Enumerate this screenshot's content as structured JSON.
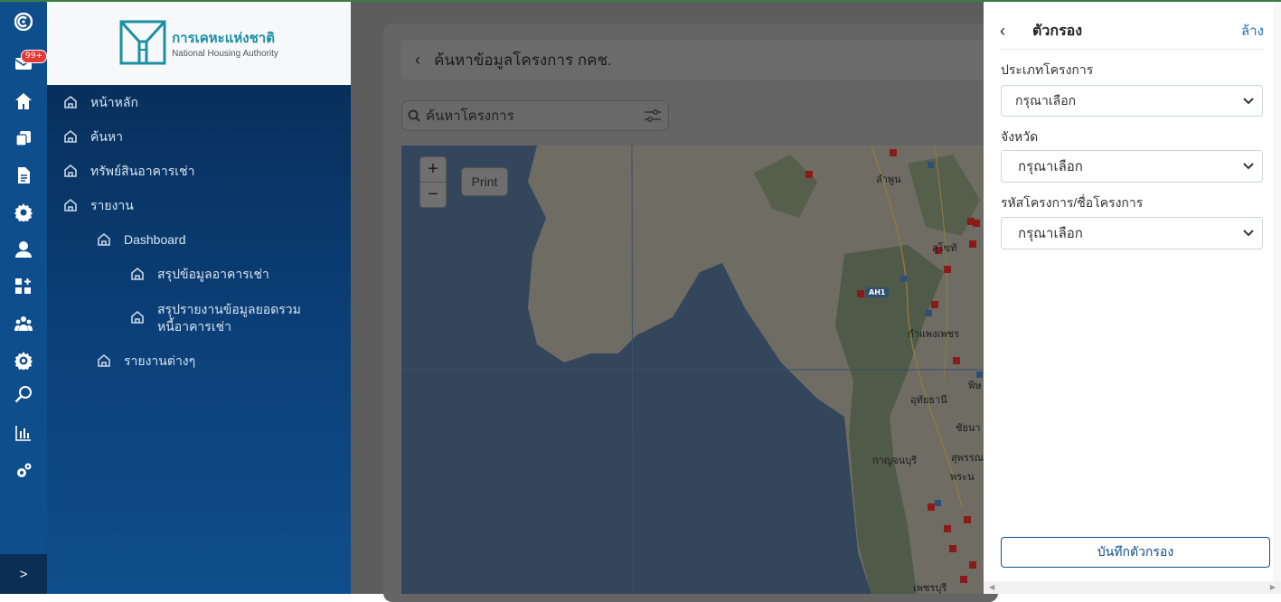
{
  "colors": {
    "rail_bg": "#0f4e8c",
    "nav_bg": "#072a52",
    "accent_link": "#1f6fc5",
    "badge": "#e53935"
  },
  "rail": {
    "badge": "99+",
    "icons": [
      "app-logo-icon",
      "mail-icon",
      "home-icon",
      "copy-icon",
      "document-icon",
      "gear-icon",
      "user-icon",
      "widgets-icon",
      "group-icon",
      "coin-settings-icon",
      "search-icon",
      "chart-icon",
      "settings-icon"
    ],
    "expand_label": ">"
  },
  "logo": {
    "thai": "การเคหะแห่งชาติ",
    "english": "National Housing Authority"
  },
  "nav": {
    "items": [
      {
        "label": "หน้าหลัก"
      },
      {
        "label": "ค้นหา"
      },
      {
        "label": "ทรัพย์สินอาคารเช่า"
      },
      {
        "label": "รายงาน"
      },
      {
        "label": "Dashboard"
      },
      {
        "label": "สรุปข้อมูลอาคารเช่า"
      },
      {
        "label": "สรุปรายงานข้อมูลยอดรวมหนี้อาคารเช่า"
      },
      {
        "label": "รายงานต่างๆ"
      }
    ]
  },
  "main": {
    "title": "ค้นหาข้อมูลโครงการ กคช.",
    "search_placeholder": "ค้นหาโครงการ"
  },
  "map": {
    "zoom_in": "+",
    "zoom_out": "−",
    "print": "Print",
    "road_badge": "AH1",
    "labels": [
      {
        "id": "lamphun",
        "text": "ลำพูน"
      },
      {
        "id": "sukhothai",
        "text": "สุโขทั"
      },
      {
        "id": "kamphaengphet",
        "text": "กำแพงเพชร"
      },
      {
        "id": "uthaithani",
        "text": "อุทัยธานี"
      },
      {
        "id": "chainat",
        "text": "ชัยนา"
      },
      {
        "id": "suphanburi",
        "text": "สุพรรณบุรี"
      },
      {
        "id": "kanchanaburi",
        "text": "กาญจนบุรี"
      },
      {
        "id": "ayutthaya",
        "text": "พระน"
      },
      {
        "id": "phitsanulok",
        "text": "พิษ"
      },
      {
        "id": "phetchaburi",
        "text": "เพชรบุรี"
      }
    ]
  },
  "filter": {
    "title": "ตัวกรอง",
    "clear": "ล้าง",
    "fields": [
      {
        "label": "ประเภทโครงการ",
        "value": "กรุณาเลือก"
      },
      {
        "label": "จังหวัด",
        "value": "กรุณาเลือก"
      },
      {
        "label": "รหัสโครงการ/ชื่อโครงการ",
        "value": "กรุณาเลือก"
      }
    ],
    "save": "บันทึกตัวกรอง"
  }
}
